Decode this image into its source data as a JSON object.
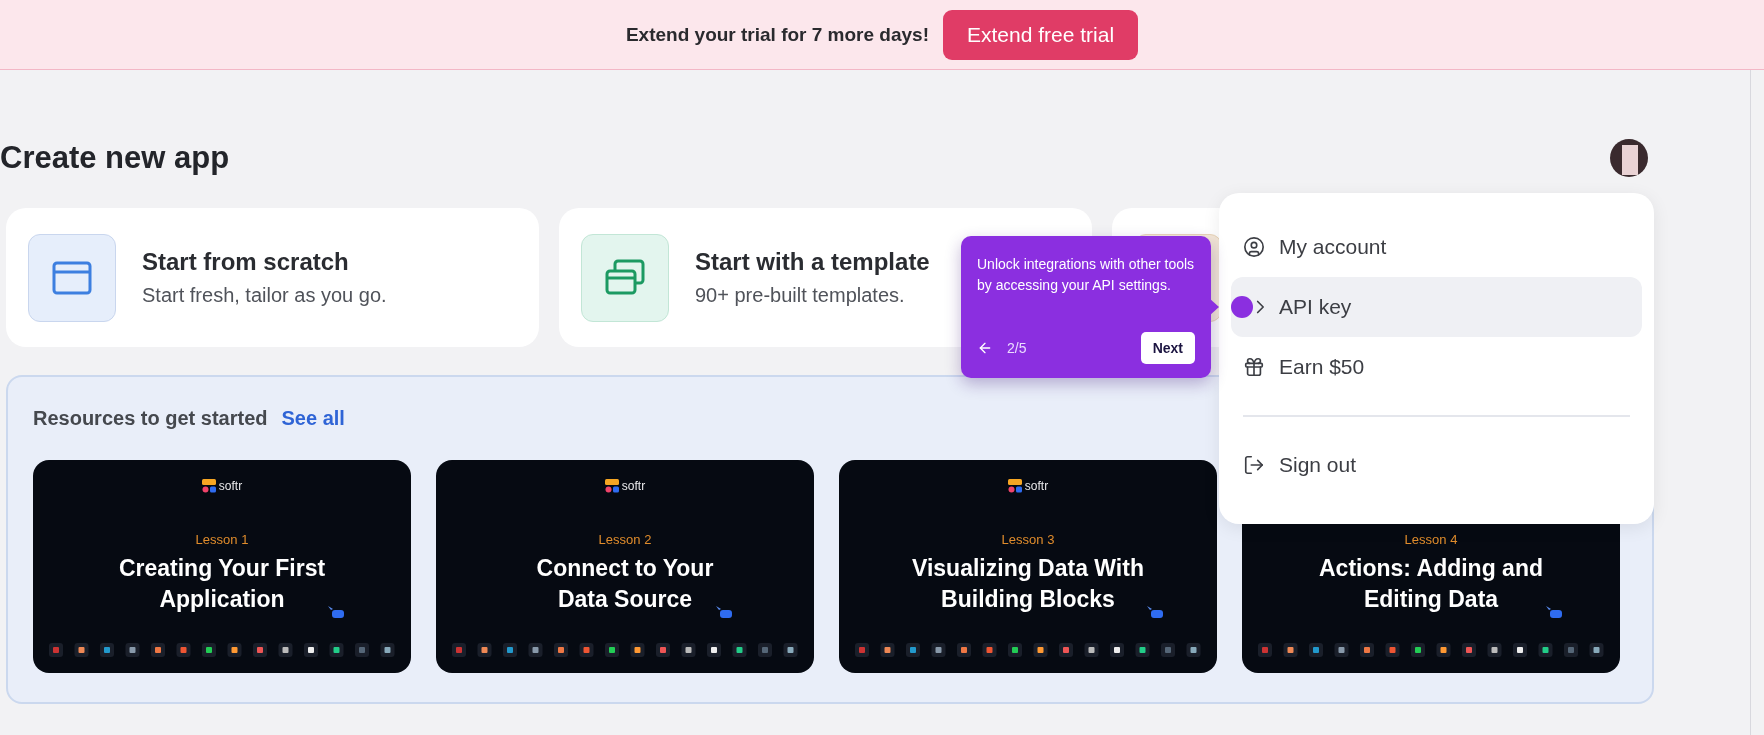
{
  "banner": {
    "message": "Extend your trial for 7 more days!",
    "button": "Extend free trial"
  },
  "page": {
    "title": "Create new app"
  },
  "create_options": [
    {
      "kind": "scratch",
      "title": "Start from scratch",
      "subtitle": "Start fresh, tailor as you go."
    },
    {
      "kind": "template",
      "title": "Start with a template",
      "subtitle": "90+ pre-built templates."
    },
    {
      "kind": "other"
    }
  ],
  "resources": {
    "title": "Resources to get started",
    "link": "See all",
    "lessons": [
      {
        "brand": "softr",
        "label": "Lesson 1",
        "title_lines": [
          "Creating Your First",
          "Application"
        ]
      },
      {
        "brand": "softr",
        "label": "Lesson 2",
        "title_lines": [
          "Connect to Your",
          "Data Source"
        ]
      },
      {
        "brand": "softr",
        "label": "Lesson 3",
        "title_lines": [
          "Visualizing Data With",
          "Building Blocks"
        ]
      },
      {
        "label": "Lesson 4",
        "title_lines": [
          "Actions: Adding and",
          "Editing Data"
        ]
      }
    ]
  },
  "user_menu": {
    "items": [
      {
        "kind": "account",
        "label": "My account",
        "selected": false
      },
      {
        "kind": "api",
        "label": "API key",
        "selected": true
      },
      {
        "kind": "earn",
        "label": "Earn $50",
        "selected": false
      },
      {
        "kind": "signout",
        "label": "Sign out",
        "selected": false
      }
    ]
  },
  "tour_tooltip": {
    "text": "Unlock integrations with other tools by accessing your API settings.",
    "step": "2/5",
    "button": "Next"
  }
}
